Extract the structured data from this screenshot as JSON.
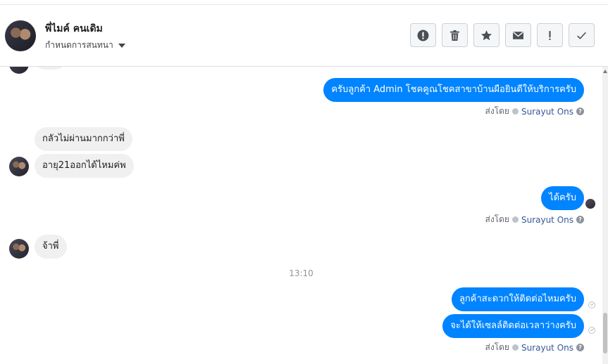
{
  "header": {
    "contact_name": "พี่ไมค์ คนเดิม",
    "conversation_menu_label": "กำหนดการสนทนา"
  },
  "toolbar": {
    "icons": [
      "alert-icon",
      "trash-icon",
      "star-icon",
      "envelope-icon",
      "exclamation-icon",
      "check-icon"
    ]
  },
  "thread": {
    "messages": [
      {
        "side": "out",
        "text": "ครับลูกค้า Admin โชคคูณโชคสาขาบ้านผือยินดีให้บริการครับ"
      },
      {
        "side": "in",
        "text": "กลัวไม่ผ่านมากกว่าพี่"
      },
      {
        "side": "in",
        "text": "อายุ21ออกได้ไหมค่พ"
      },
      {
        "side": "out",
        "text": "ได้ครับ"
      },
      {
        "side": "in",
        "text": "จ้าพี่"
      },
      {
        "side": "out",
        "text": "ลูกค้าสะดวกให้ติดต่อไหมครับ"
      },
      {
        "side": "out",
        "text": "จะได้ให้เซลล์ติดต่อเวลาว่างครับ"
      }
    ],
    "timestamp": "13:10",
    "sent_by_label": "ส่งโดย",
    "agent_name": "Surayut Ons",
    "help_glyph": "?"
  },
  "colors": {
    "outgoing_bubble": "#0084ff",
    "incoming_bubble": "#f0f0f0",
    "agent_link": "#365899"
  }
}
